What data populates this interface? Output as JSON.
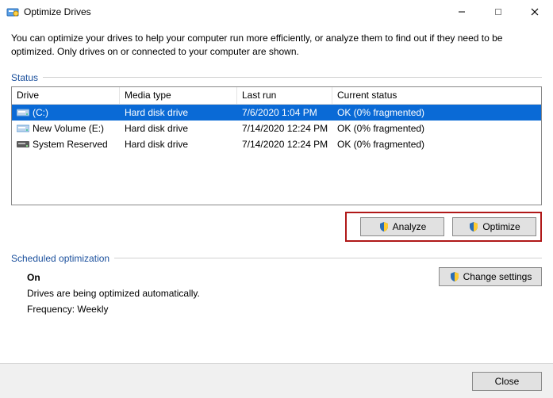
{
  "window": {
    "title": "Optimize Drives",
    "description": "You can optimize your drives to help your computer run more efficiently, or analyze them to find out if they need to be optimized. Only drives on or connected to your computer are shown."
  },
  "status": {
    "label": "Status",
    "columns": {
      "drive": "Drive",
      "media": "Media type",
      "last": "Last run",
      "status": "Current status"
    },
    "rows": [
      {
        "drive": "(C:)",
        "media": "Hard disk drive",
        "last": "7/6/2020 1:04 PM",
        "status": "OK (0% fragmented)",
        "selected": true,
        "icon": "hdd"
      },
      {
        "drive": "New Volume (E:)",
        "media": "Hard disk drive",
        "last": "7/14/2020 12:24 PM",
        "status": "OK (0% fragmented)",
        "selected": false,
        "icon": "hdd"
      },
      {
        "drive": "System Reserved",
        "media": "Hard disk drive",
        "last": "7/14/2020 12:24 PM",
        "status": "OK (0% fragmented)",
        "selected": false,
        "icon": "hdd-dark"
      }
    ]
  },
  "actions": {
    "analyze": "Analyze",
    "optimize": "Optimize"
  },
  "schedule": {
    "label": "Scheduled optimization",
    "state": "On",
    "line1": "Drives are being optimized automatically.",
    "frequency": "Frequency: Weekly",
    "change": "Change settings"
  },
  "footer": {
    "close": "Close"
  }
}
